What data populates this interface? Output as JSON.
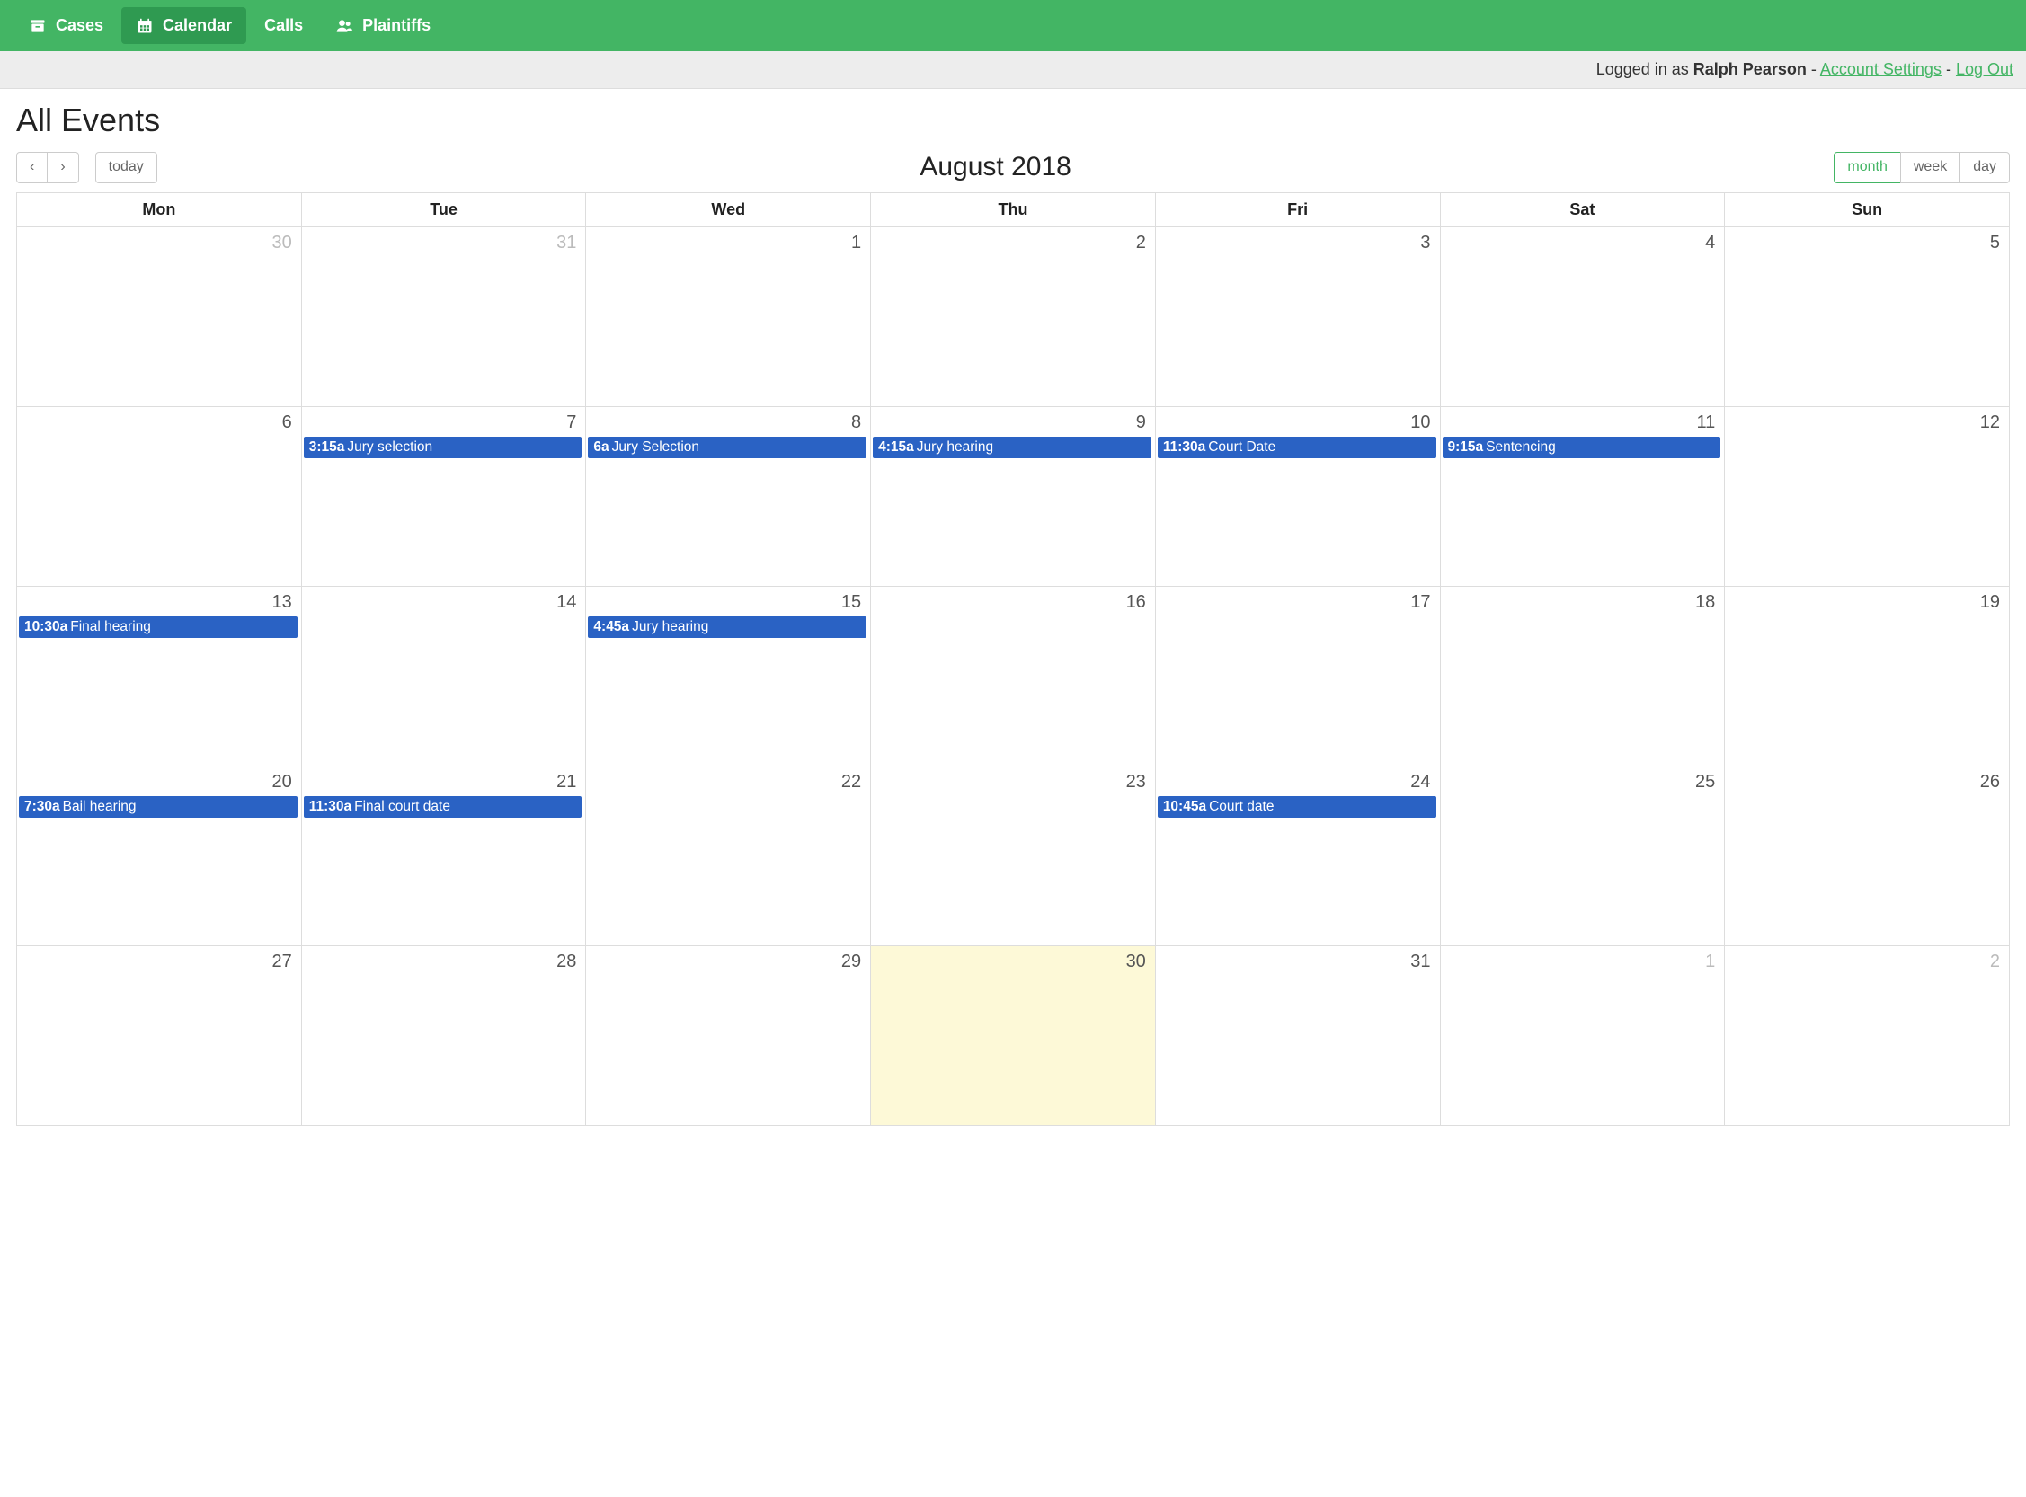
{
  "nav": {
    "items": [
      {
        "label": "Cases",
        "icon": "archive-icon",
        "active": false
      },
      {
        "label": "Calendar",
        "icon": "calendar-icon",
        "active": true
      },
      {
        "label": "Calls",
        "icon": "",
        "active": false
      },
      {
        "label": "Plaintiffs",
        "icon": "users-icon",
        "active": false
      }
    ]
  },
  "userbar": {
    "prefix": "Logged in as ",
    "username": "Ralph Pearson",
    "sep": " - ",
    "account_settings": "Account Settings",
    "log_out": "Log Out"
  },
  "page": {
    "title": "All Events"
  },
  "toolbar": {
    "prev": "‹",
    "next": "›",
    "today": "today",
    "title": "August 2018",
    "views": {
      "month": "month",
      "week": "week",
      "day": "day"
    },
    "active_view": "month"
  },
  "calendar": {
    "day_headers": [
      "Mon",
      "Tue",
      "Wed",
      "Thu",
      "Fri",
      "Sat",
      "Sun"
    ],
    "weeks": [
      [
        {
          "num": "30",
          "other": true,
          "today": false,
          "events": []
        },
        {
          "num": "31",
          "other": true,
          "today": false,
          "events": []
        },
        {
          "num": "1",
          "other": false,
          "today": false,
          "events": []
        },
        {
          "num": "2",
          "other": false,
          "today": false,
          "events": []
        },
        {
          "num": "3",
          "other": false,
          "today": false,
          "events": []
        },
        {
          "num": "4",
          "other": false,
          "today": false,
          "events": []
        },
        {
          "num": "5",
          "other": false,
          "today": false,
          "events": []
        }
      ],
      [
        {
          "num": "6",
          "other": false,
          "today": false,
          "events": []
        },
        {
          "num": "7",
          "other": false,
          "today": false,
          "events": [
            {
              "time": "3:15a",
              "title": "Jury selection"
            }
          ]
        },
        {
          "num": "8",
          "other": false,
          "today": false,
          "events": [
            {
              "time": "6a",
              "title": "Jury Selection"
            }
          ]
        },
        {
          "num": "9",
          "other": false,
          "today": false,
          "events": [
            {
              "time": "4:15a",
              "title": "Jury hearing"
            }
          ]
        },
        {
          "num": "10",
          "other": false,
          "today": false,
          "events": [
            {
              "time": "11:30a",
              "title": "Court Date"
            }
          ]
        },
        {
          "num": "11",
          "other": false,
          "today": false,
          "events": [
            {
              "time": "9:15a",
              "title": "Sentencing"
            }
          ]
        },
        {
          "num": "12",
          "other": false,
          "today": false,
          "events": []
        }
      ],
      [
        {
          "num": "13",
          "other": false,
          "today": false,
          "events": [
            {
              "time": "10:30a",
              "title": "Final hearing"
            }
          ]
        },
        {
          "num": "14",
          "other": false,
          "today": false,
          "events": []
        },
        {
          "num": "15",
          "other": false,
          "today": false,
          "events": [
            {
              "time": "4:45a",
              "title": "Jury hearing"
            }
          ]
        },
        {
          "num": "16",
          "other": false,
          "today": false,
          "events": []
        },
        {
          "num": "17",
          "other": false,
          "today": false,
          "events": []
        },
        {
          "num": "18",
          "other": false,
          "today": false,
          "events": []
        },
        {
          "num": "19",
          "other": false,
          "today": false,
          "events": []
        }
      ],
      [
        {
          "num": "20",
          "other": false,
          "today": false,
          "events": [
            {
              "time": "7:30a",
              "title": "Bail hearing"
            }
          ]
        },
        {
          "num": "21",
          "other": false,
          "today": false,
          "events": [
            {
              "time": "11:30a",
              "title": "Final court date"
            }
          ]
        },
        {
          "num": "22",
          "other": false,
          "today": false,
          "events": []
        },
        {
          "num": "23",
          "other": false,
          "today": false,
          "events": []
        },
        {
          "num": "24",
          "other": false,
          "today": false,
          "events": [
            {
              "time": "10:45a",
              "title": "Court date"
            }
          ]
        },
        {
          "num": "25",
          "other": false,
          "today": false,
          "events": []
        },
        {
          "num": "26",
          "other": false,
          "today": false,
          "events": []
        }
      ],
      [
        {
          "num": "27",
          "other": false,
          "today": false,
          "events": []
        },
        {
          "num": "28",
          "other": false,
          "today": false,
          "events": []
        },
        {
          "num": "29",
          "other": false,
          "today": false,
          "events": []
        },
        {
          "num": "30",
          "other": false,
          "today": true,
          "events": []
        },
        {
          "num": "31",
          "other": false,
          "today": false,
          "events": []
        },
        {
          "num": "1",
          "other": true,
          "today": false,
          "events": []
        },
        {
          "num": "2",
          "other": true,
          "today": false,
          "events": []
        }
      ]
    ]
  }
}
